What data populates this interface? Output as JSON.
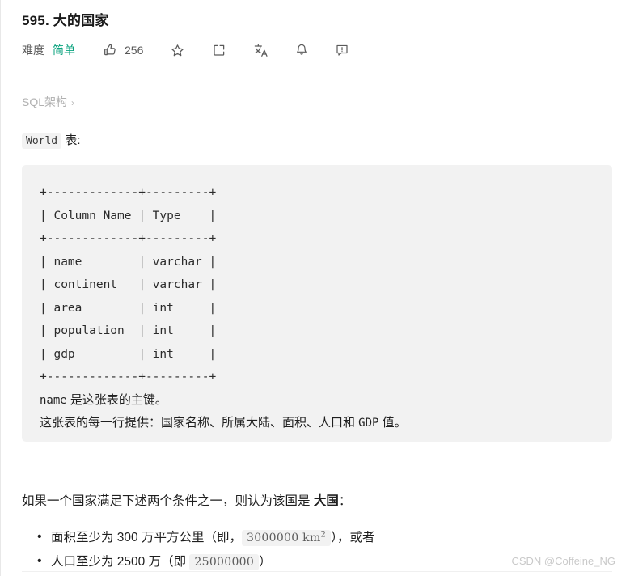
{
  "problem": {
    "title": "595. 大的国家",
    "difficulty_label": "难度",
    "difficulty_value": "简单",
    "like_count": "256"
  },
  "toolbar": {
    "like_icon": "thumbs-up-icon",
    "star_icon": "star-icon",
    "share_icon": "share-icon",
    "translate_icon": "translate-icon",
    "bell_icon": "bell-icon",
    "feedback_icon": "feedback-icon"
  },
  "breadcrumb": {
    "label": "SQL架构",
    "chevron": "›"
  },
  "table_section": {
    "code_name": "World",
    "caption_suffix": "表:",
    "ascii_table": "+-------------+---------+\n| Column Name | Type    |\n+-------------+---------+\n| name        | varchar |\n| continent   | varchar |\n| area        | int     |\n| population  | int     |\n| gdp         | int     |\n+-------------+---------+",
    "note_primary_key_mono": "name",
    "note_primary_key_text": " 是这张表的主键。",
    "note_row_prefix": "这张表的每一行提供：国家名称、所属大陆、面积、人口和 ",
    "note_row_mono": "GDP",
    "note_row_suffix": " 值。"
  },
  "body": {
    "intro_prefix": "如果一个国家满足下述两个条件之一，则认为该国是 ",
    "intro_bold": "大国",
    "intro_suffix": "：",
    "bullets": [
      {
        "prefix": "面积至少为 300 万平方公里（即，",
        "code_value": "3000000  km",
        "code_sup": "2",
        "suffix": "），或者"
      },
      {
        "prefix": "人口至少为 2500 万（即 ",
        "code_value": "25000000",
        "code_sup": "",
        "suffix": "）"
      }
    ]
  },
  "watermark": {
    "text": "CSDN @Coffeine_NG"
  },
  "colors": {
    "difficulty_green": "#0ca37f",
    "code_bg": "#f2f2f2",
    "text": "#1f1f1f",
    "muted": "#b0b0b0"
  }
}
